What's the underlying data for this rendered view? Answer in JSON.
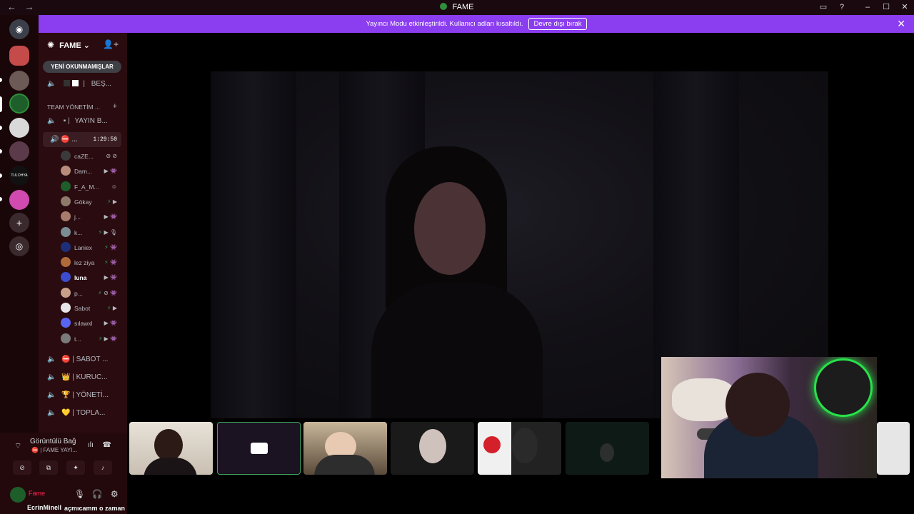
{
  "window": {
    "title": "FAME",
    "back_icon": "arrow-left-icon",
    "forward_icon": "arrow-right-icon"
  },
  "banner": {
    "text": "Yayıncı Modu etkinleştirildi. Kullanıcı adları kısaltıldı.",
    "button": "Devre dışı bırak"
  },
  "server": {
    "name": "FAME",
    "unread_label": "YENİ OKUNMAMIŞLAR",
    "top_channel": "BEŞ...",
    "category": "TEAM YÖNETİM ...",
    "channel_yayin": "YAYIN B...",
    "active_channel": {
      "name": "...",
      "timer": "1:29:50"
    },
    "members": [
      {
        "name": "caZE...",
        "color": "#3a3a3a"
      },
      {
        "name": "Dam...",
        "color": "#b98b7a"
      },
      {
        "name": "F_A_M...",
        "color": "#1d5e2b"
      },
      {
        "name": "Gökay",
        "color": "#8d7a6b"
      },
      {
        "name": "j...",
        "color": "#a77c6c"
      },
      {
        "name": "k...",
        "color": "#7a8c94"
      },
      {
        "name": "Laniex",
        "color": "#1e2f7a"
      },
      {
        "name": "lez ziya",
        "color": "#b06a3a"
      },
      {
        "name": "luna",
        "color": "#3c4cd0"
      },
      {
        "name": "p...",
        "color": "#c8a08a"
      },
      {
        "name": "Sabot",
        "color": "#e6e6e6"
      },
      {
        "name": "sılawxl",
        "color": "#5865f2"
      },
      {
        "name": "t...",
        "color": "#7a7a7a"
      }
    ],
    "lower_channels": [
      {
        "name": "SABOT ...",
        "emoji": "⛔"
      },
      {
        "name": "KURUC...",
        "emoji": "👑"
      },
      {
        "name": "YÖNETİ...",
        "emoji": "🏆"
      },
      {
        "name": "TOPLA...",
        "emoji": "💛"
      }
    ]
  },
  "voice": {
    "status": "Görüntülü Bağ",
    "channel": "| FAME YAYI...",
    "user": "Fame"
  },
  "captions": {
    "left": "EcrinMinell",
    "right": "açmıcamm o zaman"
  }
}
